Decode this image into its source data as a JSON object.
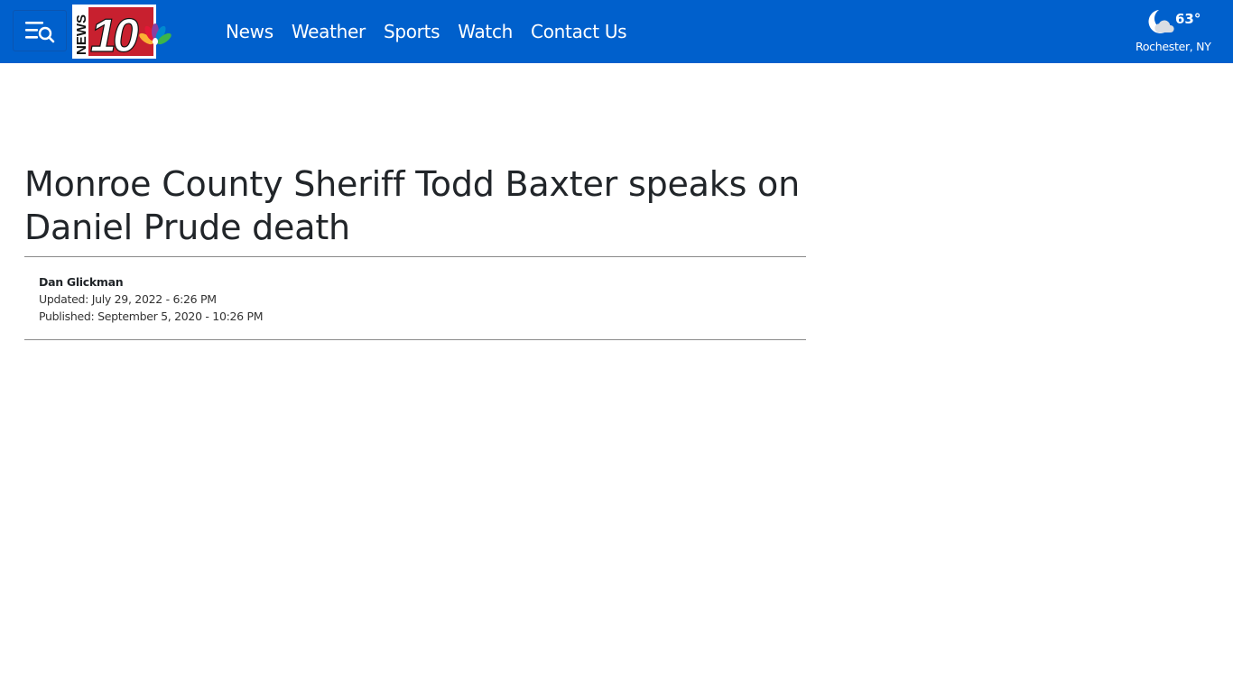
{
  "header": {
    "menu_icon": "menu-search-icon",
    "logo": {
      "text_news": "NEWS",
      "text_number": "10",
      "icon": "nbc-peacock-icon"
    },
    "nav": [
      {
        "label": "News"
      },
      {
        "label": "Weather"
      },
      {
        "label": "Sports"
      },
      {
        "label": "Watch"
      },
      {
        "label": "Contact Us"
      }
    ],
    "weather": {
      "icon": "moon-cloud-icon",
      "temperature": "63°",
      "location": "Rochester, NY"
    }
  },
  "article": {
    "headline": "Monroe County Sheriff Todd Baxter speaks on Daniel Prude death",
    "author": "Dan Glickman",
    "updated": "Updated: July 29, 2022 - 6:26 PM",
    "published": "Published: September 5, 2020 - 10:26 PM"
  },
  "colors": {
    "header_bg": "#0060cc",
    "text": "#212529"
  }
}
